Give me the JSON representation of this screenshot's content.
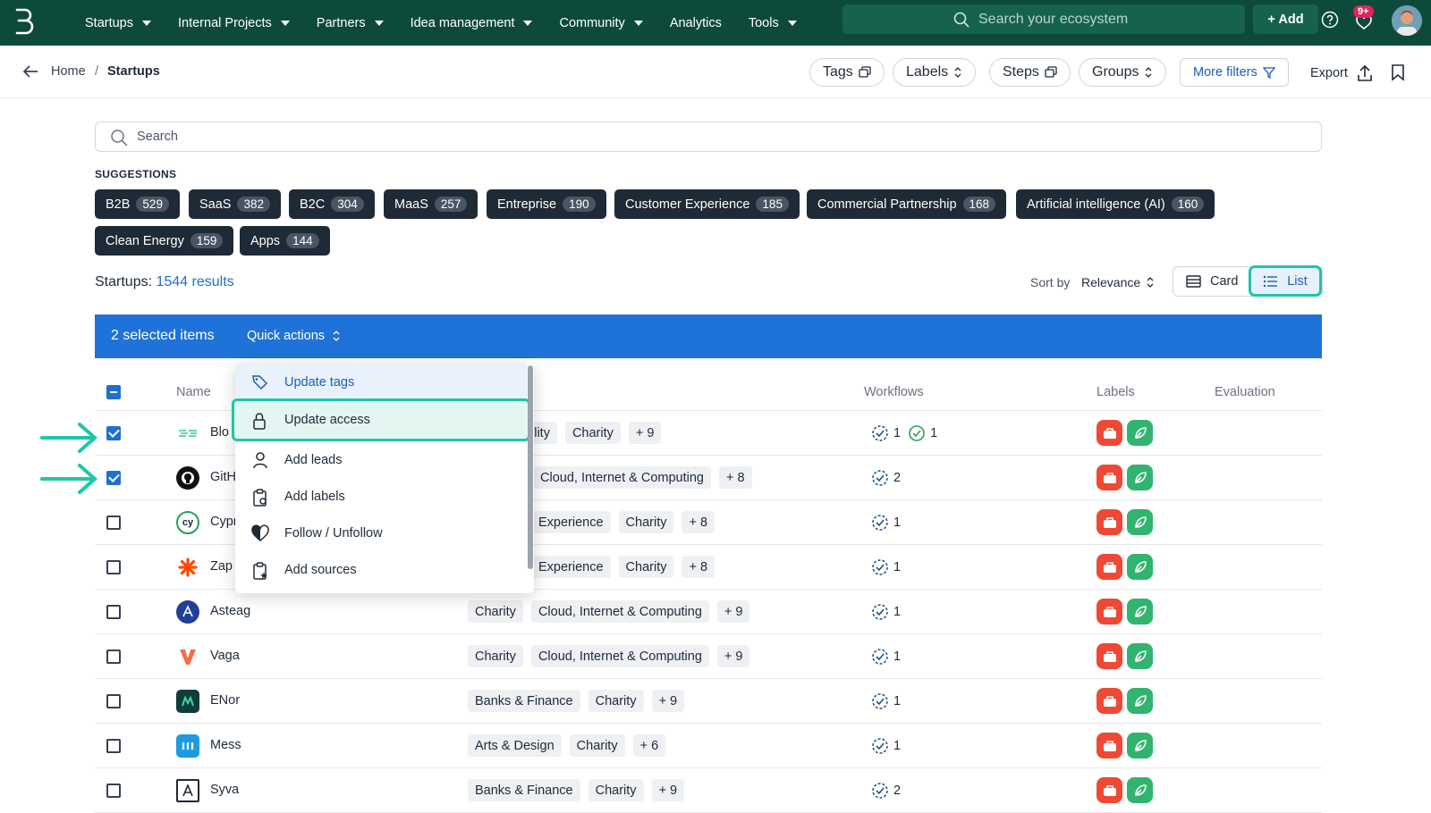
{
  "nav": {
    "items": [
      "Startups",
      "Internal Projects",
      "Partners",
      "Idea management",
      "Community",
      "Analytics",
      "Tools"
    ],
    "search_placeholder": "Search your ecosystem",
    "add_label": "+ Add",
    "notif_count": "9+"
  },
  "breadcrumb": {
    "home": "Home",
    "sep": "/",
    "current": "Startups"
  },
  "filters": {
    "tags": "Tags",
    "labels": "Labels",
    "steps": "Steps",
    "groups": "Groups",
    "more": "More filters",
    "export": "Export"
  },
  "search": {
    "placeholder": "Search"
  },
  "suggestions": {
    "label": "SUGGESTIONS",
    "tags": [
      {
        "name": "B2B",
        "count": "529"
      },
      {
        "name": "SaaS",
        "count": "382"
      },
      {
        "name": "B2C",
        "count": "304"
      },
      {
        "name": "MaaS",
        "count": "257"
      },
      {
        "name": "Entreprise",
        "count": "190"
      },
      {
        "name": "Customer Experience",
        "count": "185"
      },
      {
        "name": "Commercial Partnership",
        "count": "168"
      },
      {
        "name": "Artificial intelligence (AI)",
        "count": "160"
      },
      {
        "name": "Clean Energy",
        "count": "159"
      },
      {
        "name": "Apps",
        "count": "144"
      }
    ]
  },
  "results": {
    "label": "Startups:",
    "count": "1544 results"
  },
  "sort": {
    "label": "Sort by",
    "value": "Relevance"
  },
  "view": {
    "card": "Card",
    "list": "List",
    "active": "List"
  },
  "selection": {
    "count_label": "2 selected items",
    "quick_actions": "Quick actions"
  },
  "table": {
    "headers": {
      "name": "Name",
      "workflows": "Workflows",
      "labels": "Labels",
      "evaluation": "Evaluation"
    },
    "rows": [
      {
        "name": "Blo",
        "checked": true,
        "tags": [
          "ility",
          "Charity",
          "+ 9"
        ],
        "wf1": "1",
        "wf2": "1"
      },
      {
        "name": "GitH",
        "checked": true,
        "tags": [
          "Cloud, Internet & Computing",
          "+ 8"
        ],
        "wf1": "2"
      },
      {
        "name": "Cypr",
        "checked": false,
        "tags": [
          "Experience",
          "Charity",
          "+ 8"
        ],
        "wf1": "1"
      },
      {
        "name": "Zap",
        "checked": false,
        "tags": [
          "Experience",
          "Charity",
          "+ 8"
        ],
        "wf1": "1"
      },
      {
        "name": "Asteag",
        "checked": false,
        "tags": [
          "Charity",
          "Cloud, Internet & Computing",
          "+ 9"
        ],
        "wf1": "1"
      },
      {
        "name": "Vaga",
        "checked": false,
        "tags": [
          "Charity",
          "Cloud, Internet & Computing",
          "+ 9"
        ],
        "wf1": "1"
      },
      {
        "name": "ENor",
        "checked": false,
        "tags": [
          "Banks & Finance",
          "Charity",
          "+ 9"
        ],
        "wf1": "1"
      },
      {
        "name": "Mess",
        "checked": false,
        "tags": [
          "Arts & Design",
          "Charity",
          "+ 6"
        ],
        "wf1": "1"
      },
      {
        "name": "Syva",
        "checked": false,
        "tags": [
          "Banks & Finance",
          "Charity",
          "+ 9"
        ],
        "wf1": "2"
      }
    ]
  },
  "menu": {
    "items": [
      "Update tags",
      "Update access",
      "Add leads",
      "Add labels",
      "Follow / Unfollow",
      "Add sources"
    ],
    "highlighted": "Update access"
  },
  "colors": {
    "nav_bg": "#0e4a3c",
    "selection_bar": "#1f73d8",
    "highlight": "#1ec7a5",
    "label_red": "#ef4834",
    "label_green": "#30b46f"
  }
}
